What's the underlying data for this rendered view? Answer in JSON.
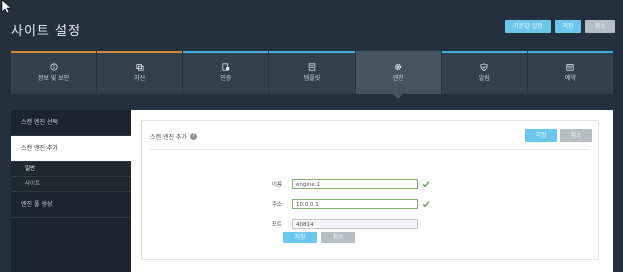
{
  "page": {
    "title": "사이트 설정"
  },
  "top_actions": [
    {
      "label": "기본값 설정",
      "style": "blue"
    },
    {
      "label": "저장",
      "style": "blue"
    },
    {
      "label": "취소",
      "style": "gray"
    }
  ],
  "tabs": [
    {
      "label": "정보 및 보안",
      "icon": "info-icon"
    },
    {
      "label": "자산",
      "icon": "asset-icon"
    },
    {
      "label": "인증",
      "icon": "auth-icon"
    },
    {
      "label": "템플릿",
      "icon": "template-icon"
    },
    {
      "label": "엔진",
      "icon": "gear-icon",
      "active": true
    },
    {
      "label": "알림",
      "icon": "shield-icon"
    },
    {
      "label": "예약",
      "icon": "calendar-icon"
    }
  ],
  "sidebar": {
    "items": [
      {
        "label": "스캔 엔진 선택"
      },
      {
        "label": "스캔 엔진 추가",
        "active": true,
        "subitems": [
          {
            "label": "일반",
            "active": true
          },
          {
            "label": "사이트"
          }
        ]
      },
      {
        "label": "엔진 풀 생성"
      }
    ]
  },
  "panel": {
    "title": "스캔 엔진 추가",
    "save_label": "저장",
    "cancel_label": "취소"
  },
  "form": {
    "name": {
      "label": "이름",
      "value": "engine 1"
    },
    "address": {
      "label": "주소",
      "value": "10.0.0.1"
    },
    "port": {
      "label": "포트",
      "value": "40814"
    },
    "save_label": "저장",
    "cancel_label": "취소"
  },
  "colors": {
    "accent_blue": "#6cc7ec",
    "accent_orange": "#d88a36",
    "valid_green": "#5aa845"
  }
}
